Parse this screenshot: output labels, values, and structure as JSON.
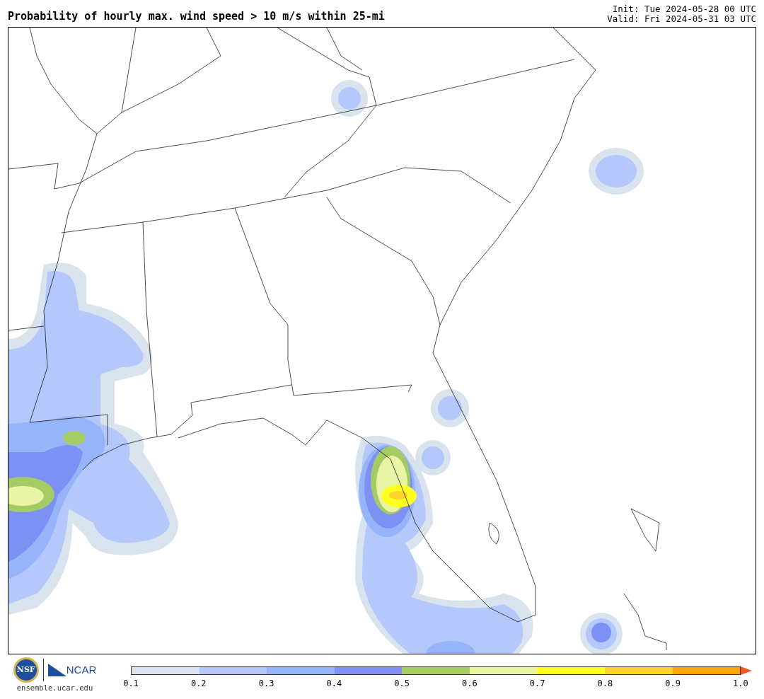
{
  "title": "Probability of hourly max. wind speed > 10 m/s within 25-mi",
  "init": "Init: Tue 2024-05-28 00 UTC",
  "valid": "Valid: Fri 2024-05-31 03 UTC",
  "logos": {
    "nsf": "NSF",
    "ncar": "NCAR",
    "url": "ensemble.ucar.edu"
  },
  "colorbar": {
    "bins": [
      {
        "color": "#d8e3ee"
      },
      {
        "color": "#b4c8fc"
      },
      {
        "color": "#96b4fa"
      },
      {
        "color": "#7d91f5"
      },
      {
        "color": "#a5cc64"
      },
      {
        "color": "#e8f5a5"
      },
      {
        "color": "#ffff20"
      },
      {
        "color": "#ffd22e"
      },
      {
        "color": "#ffa50a"
      }
    ],
    "extend_arrow": {
      "color": "#f05a1e"
    },
    "ticks": [
      "0.1",
      "0.2",
      "0.3",
      "0.4",
      "0.5",
      "0.6",
      "0.7",
      "0.8",
      "0.9",
      "1.0"
    ]
  }
}
